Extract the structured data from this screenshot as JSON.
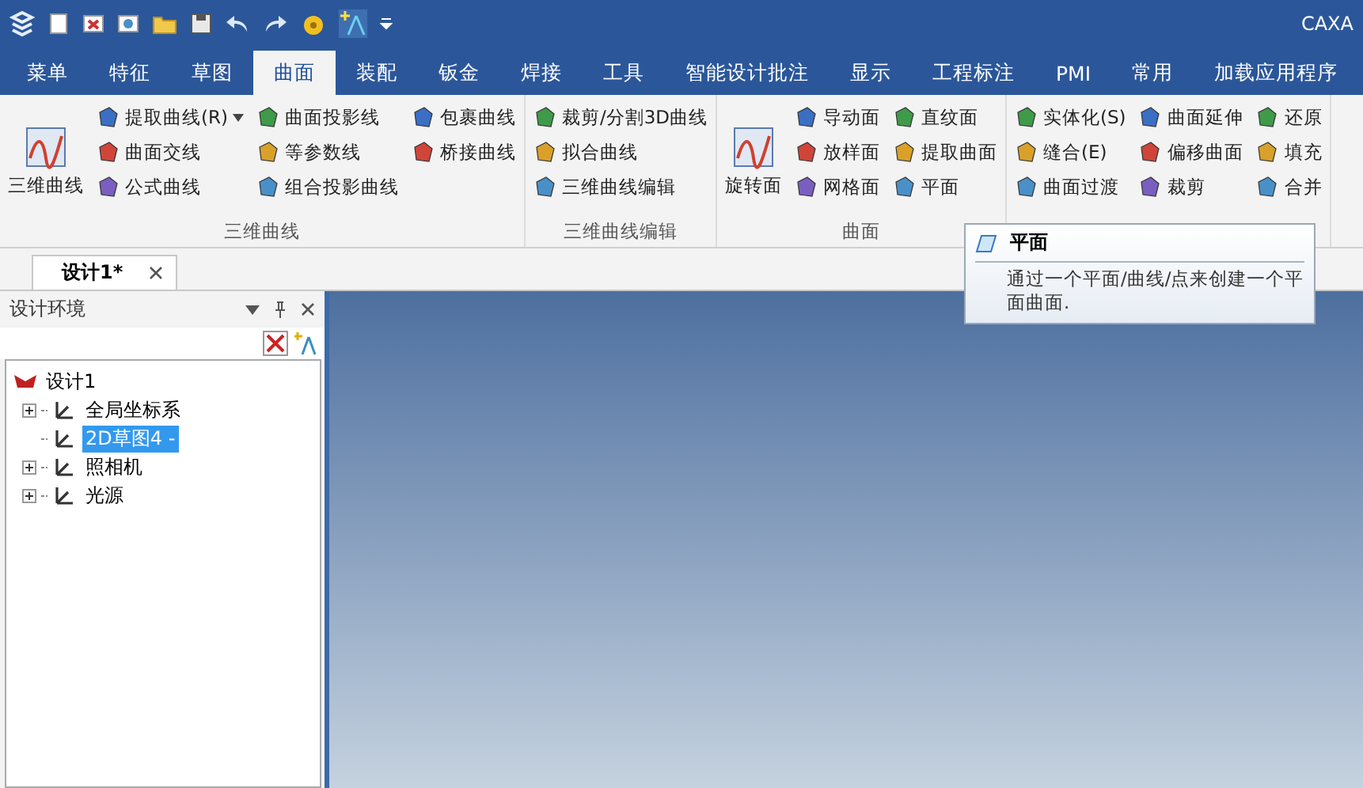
{
  "window": {
    "title": "CAXA"
  },
  "tabs": [
    {
      "label": "菜单",
      "selected": false
    },
    {
      "label": "特征",
      "selected": false
    },
    {
      "label": "草图",
      "selected": false
    },
    {
      "label": "曲面",
      "selected": true
    },
    {
      "label": "装配",
      "selected": false
    },
    {
      "label": "钣金",
      "selected": false
    },
    {
      "label": "焊接",
      "selected": false
    },
    {
      "label": "工具",
      "selected": false
    },
    {
      "label": "智能设计批注",
      "selected": false
    },
    {
      "label": "显示",
      "selected": false
    },
    {
      "label": "工程标注",
      "selected": false
    },
    {
      "label": "PMI",
      "selected": false
    },
    {
      "label": "常用",
      "selected": false
    },
    {
      "label": "加载应用程序",
      "selected": false
    }
  ],
  "ribbon": {
    "groups": [
      {
        "label": "三维曲线",
        "large": [
          {
            "label": "三维曲线"
          }
        ],
        "columns": [
          [
            {
              "label": "提取曲线(R)",
              "dropdown": true
            },
            {
              "label": "曲面交线",
              "dropdown": false
            },
            {
              "label": "公式曲线",
              "dropdown": false
            }
          ],
          [
            {
              "label": "曲面投影线",
              "dropdown": false
            },
            {
              "label": "等参数线",
              "dropdown": false
            },
            {
              "label": "组合投影曲线",
              "dropdown": false
            }
          ],
          [
            {
              "label": "包裹曲线",
              "dropdown": false
            },
            {
              "label": "桥接曲线",
              "dropdown": false
            }
          ]
        ]
      },
      {
        "label": "三维曲线编辑",
        "columns": [
          [
            {
              "label": "裁剪/分割3D曲线",
              "dropdown": false
            },
            {
              "label": "拟合曲线",
              "dropdown": false
            },
            {
              "label": "三维曲线编辑",
              "dropdown": false
            }
          ]
        ]
      },
      {
        "label": "曲面",
        "large": [
          {
            "label": "旋转面"
          }
        ],
        "columns": [
          [
            {
              "label": "导动面",
              "dropdown": false
            },
            {
              "label": "放样面",
              "dropdown": false
            },
            {
              "label": "网格面",
              "dropdown": false
            }
          ],
          [
            {
              "label": "直纹面",
              "dropdown": false
            },
            {
              "label": "提取曲面",
              "dropdown": false
            },
            {
              "label": "平面",
              "dropdown": false
            }
          ]
        ]
      },
      {
        "columns": [
          [
            {
              "label": "实体化(S)",
              "dropdown": false
            },
            {
              "label": "缝合(E)",
              "dropdown": false
            },
            {
              "label": "曲面过渡",
              "dropdown": false
            }
          ],
          [
            {
              "label": "曲面延伸",
              "dropdown": false
            },
            {
              "label": "偏移曲面",
              "dropdown": false
            },
            {
              "label": "裁剪",
              "dropdown": false
            }
          ],
          [
            {
              "label": "还原",
              "dropdown": false
            },
            {
              "label": "填充",
              "dropdown": false
            },
            {
              "label": "合并",
              "dropdown": false
            }
          ]
        ]
      }
    ]
  },
  "document_tab": {
    "label": "设计1*"
  },
  "panel": {
    "title": "设计环境",
    "tree": [
      {
        "label": "设计1",
        "expandable": false,
        "selected": false,
        "children": [
          {
            "label": "全局坐标系",
            "expandable": true,
            "selected": false
          },
          {
            "label": "2D草图4 -",
            "expandable": false,
            "selected": true
          },
          {
            "label": "照相机",
            "expandable": true,
            "selected": false
          },
          {
            "label": "光源",
            "expandable": true,
            "selected": false
          }
        ]
      }
    ]
  },
  "tooltip": {
    "title": "平面",
    "text": "通过一个平面/曲线/点来创建一个平面曲面."
  }
}
